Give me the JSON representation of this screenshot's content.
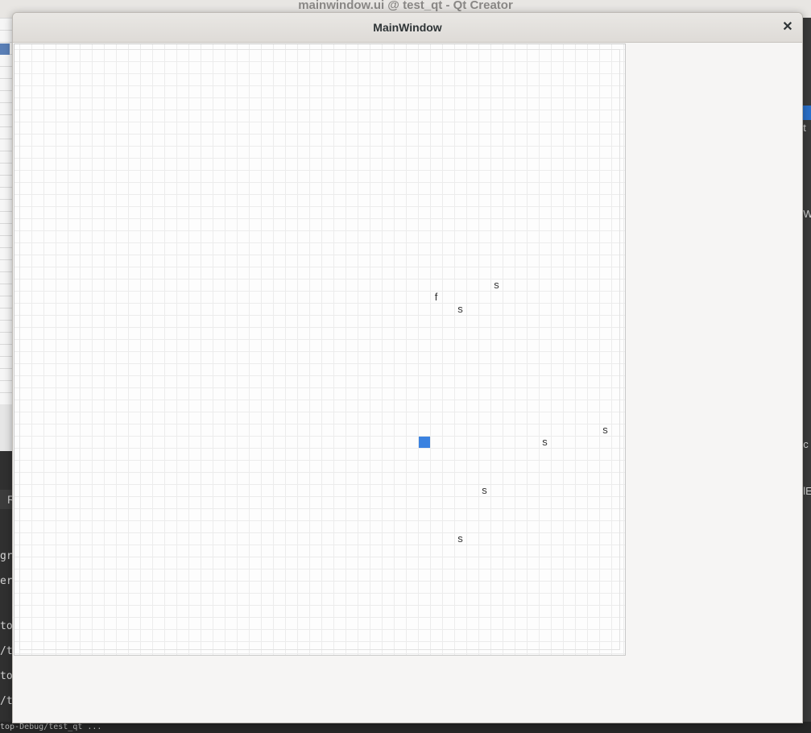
{
  "background_app": {
    "title": "mainwindow.ui @ test_qt - Qt Creator",
    "left_tab_label": "R",
    "left_texts": [
      "gr",
      "er",
      "to",
      "/t",
      "to",
      "/t"
    ],
    "right_texts": [
      "et",
      "t",
      "nW",
      "ec",
      "olE"
    ],
    "status_text": "top-Debug/test_qt ..."
  },
  "window": {
    "title": "MainWindow",
    "close_glyph": "✕"
  },
  "board": {
    "grid_cells": 50,
    "cells": [
      {
        "col": 39,
        "row": 19,
        "char": "s"
      },
      {
        "col": 34,
        "row": 20,
        "char": "f"
      },
      {
        "col": 36,
        "row": 21,
        "char": "s"
      },
      {
        "col": 48,
        "row": 31,
        "char": "s"
      },
      {
        "col": 43,
        "row": 32,
        "char": "s"
      },
      {
        "col": 38,
        "row": 36,
        "char": "s"
      },
      {
        "col": 36,
        "row": 40,
        "char": "s"
      }
    ],
    "player": {
      "col": 33,
      "row": 32,
      "color": "#3b82e0"
    }
  }
}
